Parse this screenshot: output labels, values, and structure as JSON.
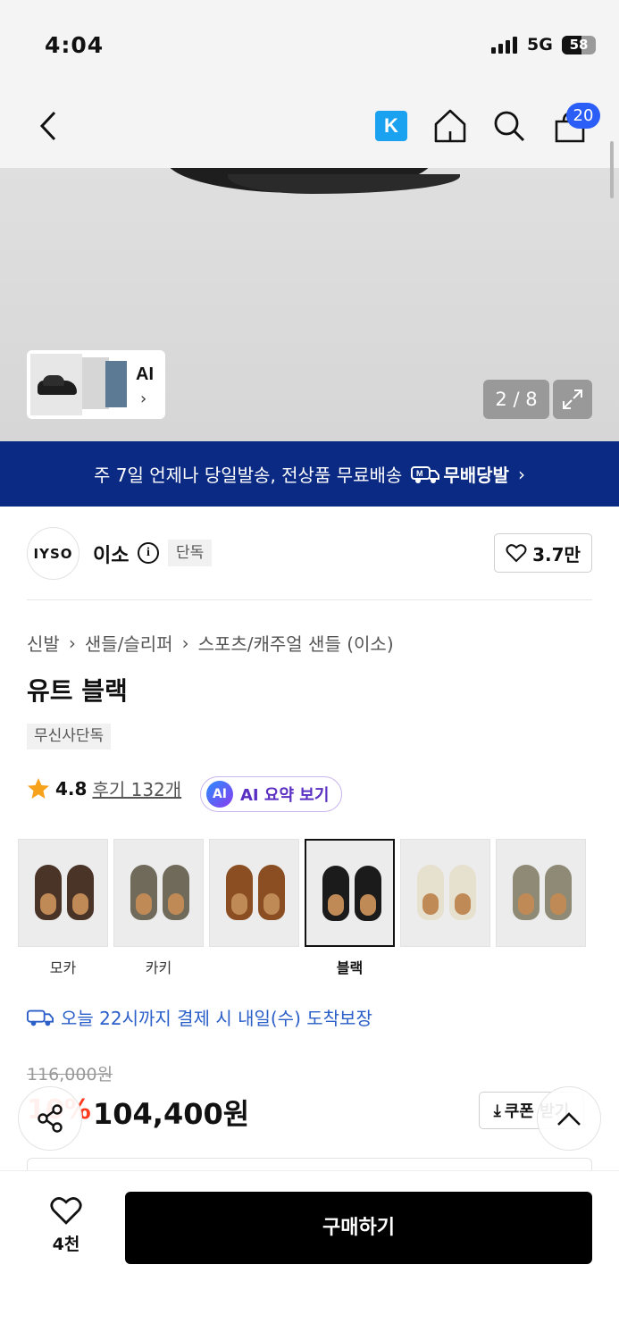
{
  "status_bar": {
    "time": "4:04",
    "network": "5G",
    "battery": "58",
    "battery_level": 0.58
  },
  "nav": {
    "back_icon": "chevron-left-icon",
    "k_badge": "K",
    "home_icon": "home-icon",
    "search_icon": "search-icon",
    "cart_icon": "shopping-bag-icon",
    "cart_count": "20"
  },
  "gallery": {
    "ai_label": "AI",
    "counter": "2 / 8",
    "expand_icon": "expand-icon"
  },
  "banner": {
    "text": "주 7일 언제나 당일발송, 전상품 무료배송",
    "badge": "무배당발",
    "badge_icon": "delivery-truck-icon"
  },
  "brand": {
    "logo_text": "IYSO",
    "name": "이소",
    "tag": "단독",
    "likes": "3.7만"
  },
  "breadcrumb": [
    "신발",
    "샌들/슬리퍼",
    "스포츠/캐주얼 샌들 (이소)"
  ],
  "product": {
    "title": "유트 블랙",
    "tag": "무신사단독",
    "rating": "4.8",
    "reviews": "후기 132개",
    "ai_summary": "AI 요약 보기"
  },
  "colors": [
    {
      "label": "모카",
      "swatch": "#4a3327",
      "active": false
    },
    {
      "label": "카키",
      "swatch": "#6f6a5a",
      "active": false
    },
    {
      "label": "",
      "swatch": "#8a4e22",
      "active": false
    },
    {
      "label": "블랙",
      "swatch": "#1b1b1b",
      "active": true
    },
    {
      "label": "",
      "swatch": "#e6e0cf",
      "active": false
    },
    {
      "label": "",
      "swatch": "#8e8a76",
      "active": false
    }
  ],
  "delivery": {
    "text": "오늘 22시까지 결제 시 내일(수) 도착보장"
  },
  "pricing": {
    "original": "116,000원",
    "discount": "10%",
    "price": "104,400원",
    "coupon": "쿠폰 받기"
  },
  "bottom": {
    "wish_count": "4천",
    "buy": "구매하기"
  },
  "accent": {
    "banner": "#0b2a83",
    "link": "#2a5ec8",
    "discount": "#ff3b1f",
    "cart_badge": "#2a5ef7"
  }
}
